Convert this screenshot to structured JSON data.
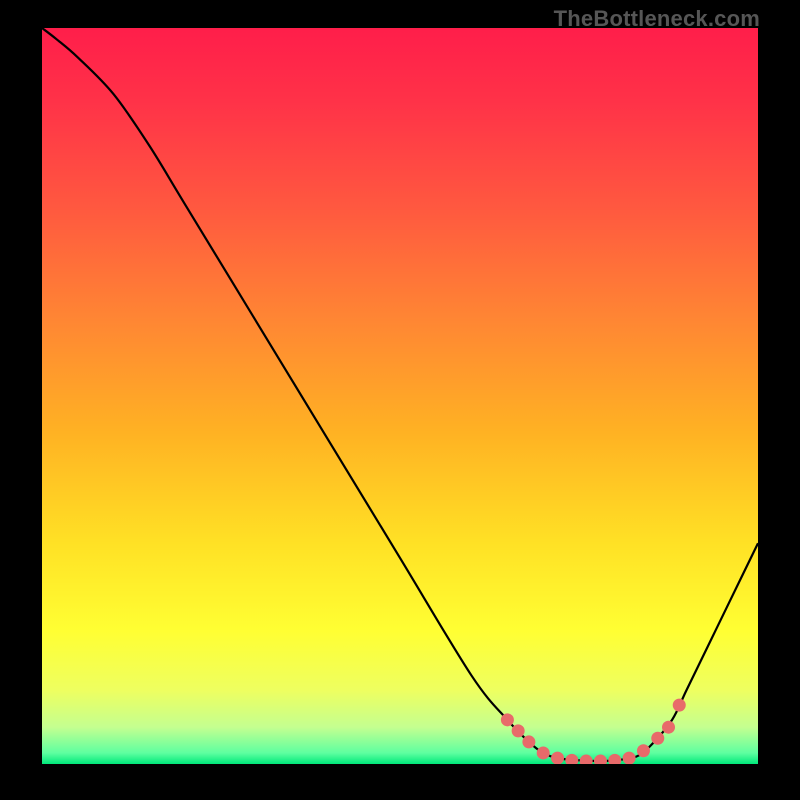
{
  "watermark": "TheBottleneck.com",
  "chart_data": {
    "type": "line",
    "title": "",
    "xlabel": "",
    "ylabel": "",
    "xlim": [
      0,
      100
    ],
    "ylim": [
      0,
      100
    ],
    "grid": false,
    "legend": false,
    "series": [
      {
        "name": "curve",
        "x": [
          0,
          2,
          5,
          10,
          15,
          20,
          30,
          40,
          50,
          60,
          65,
          68,
          70,
          72,
          75,
          78,
          80,
          83,
          85,
          88,
          90,
          93,
          96,
          100
        ],
        "y": [
          100,
          98.5,
          96,
          91,
          84,
          76,
          60,
          44,
          28,
          12,
          6,
          3,
          1.5,
          0.8,
          0.5,
          0.4,
          0.5,
          1.0,
          2.5,
          6,
          10,
          16,
          22,
          30
        ]
      }
    ],
    "markers": {
      "name": "highlight-dots",
      "color": "#e86a6a",
      "points": [
        {
          "x": 65,
          "y": 6
        },
        {
          "x": 66.5,
          "y": 4.5
        },
        {
          "x": 68,
          "y": 3
        },
        {
          "x": 70,
          "y": 1.5
        },
        {
          "x": 72,
          "y": 0.8
        },
        {
          "x": 74,
          "y": 0.5
        },
        {
          "x": 76,
          "y": 0.4
        },
        {
          "x": 78,
          "y": 0.4
        },
        {
          "x": 80,
          "y": 0.5
        },
        {
          "x": 82,
          "y": 0.8
        },
        {
          "x": 84,
          "y": 1.8
        },
        {
          "x": 86,
          "y": 3.5
        },
        {
          "x": 87.5,
          "y": 5
        },
        {
          "x": 89,
          "y": 8
        }
      ]
    },
    "background_gradient": {
      "stops": [
        {
          "offset": 0.0,
          "color": "#ff1e4a"
        },
        {
          "offset": 0.1,
          "color": "#ff3248"
        },
        {
          "offset": 0.25,
          "color": "#ff5a3f"
        },
        {
          "offset": 0.4,
          "color": "#ff8733"
        },
        {
          "offset": 0.55,
          "color": "#ffb223"
        },
        {
          "offset": 0.7,
          "color": "#ffe125"
        },
        {
          "offset": 0.82,
          "color": "#ffff33"
        },
        {
          "offset": 0.9,
          "color": "#eeff60"
        },
        {
          "offset": 0.95,
          "color": "#c4ff90"
        },
        {
          "offset": 0.985,
          "color": "#5effa0"
        },
        {
          "offset": 1.0,
          "color": "#00e87a"
        }
      ]
    }
  }
}
